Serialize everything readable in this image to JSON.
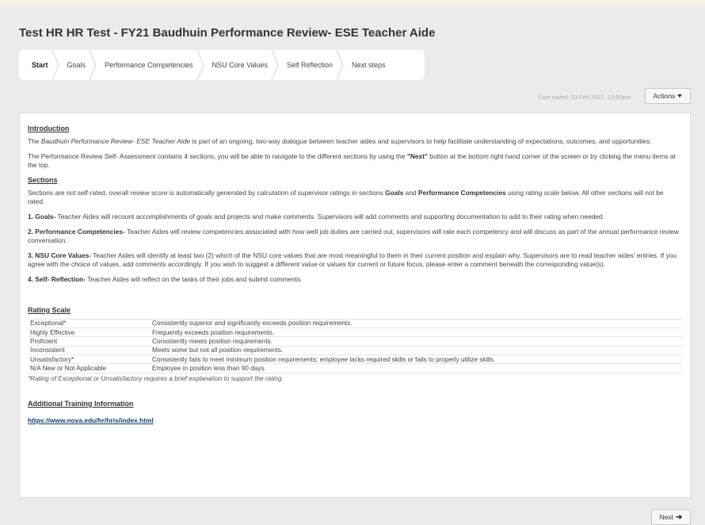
{
  "page": {
    "title": "Test HR HR Test - FY21 Baudhuin Performance Review- ESE Teacher Aide"
  },
  "wizard": {
    "steps": [
      {
        "label": "Start",
        "active": true
      },
      {
        "label": "Goals"
      },
      {
        "label": "Performance Competencies"
      },
      {
        "label": "NSU Core Values"
      },
      {
        "label": "Self Reflection"
      },
      {
        "label": "Next steps"
      }
    ]
  },
  "toolbar": {
    "last_saved": "Last saved: 20 Feb 2021, 12:50pm",
    "actions_label": "Actions"
  },
  "content": {
    "intro_heading": "Introduction",
    "intro_p1": {
      "pre": "The ",
      "italic": "Baudhuin Performance Review- ESE Teacher Aide",
      "post": " is part of an ongoing, two-way dialogue between teacher aides and supervisors to help facilitate understanding of expectations, outcomes, and opportunities."
    },
    "intro_p2": {
      "pre": "The Performance Review Self- Assessment contains 4 sections, you will be able to navigate to the different sections by using the ",
      "bold": "\"Next\"",
      "post": " button at the bottom right hand corner of the screen or by clicking the menu items at the top."
    },
    "sections_heading": "Sections",
    "sections_p": {
      "pre": "Sections are not self-rated, overall review score is automatically generated by calculation of supervisor ratings in sections ",
      "bold1": "Goals",
      "mid": " and ",
      "bold2": "Performance Competencies",
      "post": " using rating scale below. All other sections will not be rated."
    },
    "items": [
      {
        "bold": "1. Goals-",
        "text": " Teacher Aides will recount accomplishments of goals and projects and make comments. Supervisors will add comments and supporting documentation to add to their rating when needed."
      },
      {
        "bold": "2. Performance Competencies-",
        "text": " Teacher Aides will review competencies associated with how well job duties are carried out, supervisors will rate each competency and will discuss as part of the annual performance review conversation."
      },
      {
        "bold": "3. NSU Core Values-",
        "text": " Teacher Aides will identify at least two (2) which of the NSU core values that are most meaningful to them in their current position and explain why. Supervisors are to read teacher aides' entries. If you agree with the choice of values, add comments accordingly.  If you wish to suggest a different value or values for current or future focus, please enter a comment beneath the corresponding value(s)."
      },
      {
        "bold": "4. Self- Reflection-",
        "text": " Teacher Aides will reflect on the tasks of their jobs and submit comments."
      }
    ],
    "rating_heading": "Rating Scale",
    "ratings": [
      {
        "label": "Exceptional*",
        "desc": "Consistently superior and significantly exceeds position requirements."
      },
      {
        "label": "Highly Effective",
        "desc": "Frequently exceeds position requirements."
      },
      {
        "label": "Proficient",
        "desc": "Consistently meets position requirements."
      },
      {
        "label": "Inconsistent",
        "desc": "Meets some but not all position requirements."
      },
      {
        "label": "Unsatisfactory*",
        "desc": "Consistently fails to meet minimum position requirements; employee lacks required skills or fails to properly utilize skills."
      },
      {
        "label": "N/A New or Not Applicable",
        "desc": "Employee in position less than 90 days."
      }
    ],
    "rating_note": "*Rating of Exceptional or Unsatisfactory requires a brief explanation to support the rating.",
    "training_heading": "Additional Training Information",
    "training_link": "https://www.nova.edu/hr/hris/index.html"
  },
  "footer": {
    "next_label": "Next"
  },
  "colors": {
    "background": "#ebebeb",
    "panel": "#ffffff",
    "link": "#1a3f6b"
  }
}
